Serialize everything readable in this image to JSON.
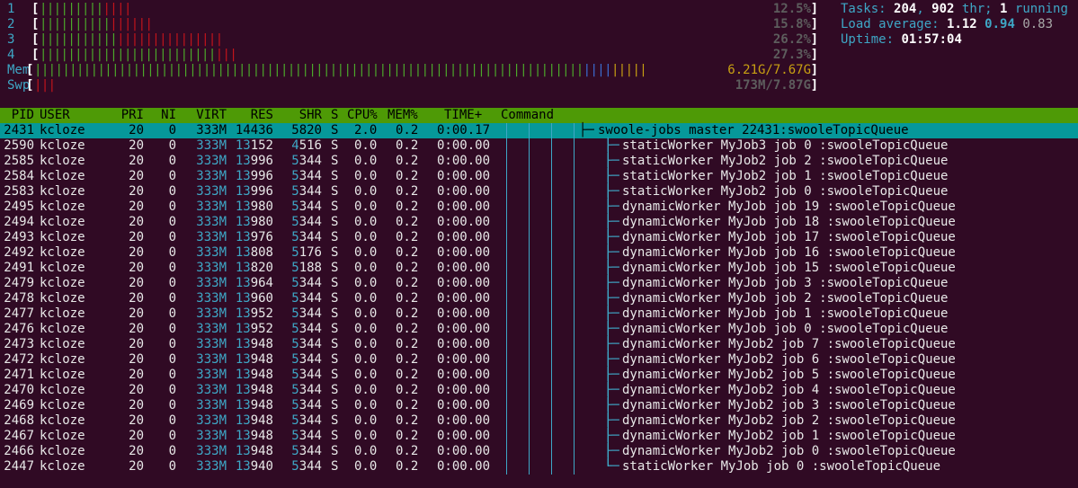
{
  "meters": {
    "cpus": [
      {
        "label": "1",
        "value": "12.5%",
        "bars": [
          {
            "c": "g",
            "n": 9
          },
          {
            "c": "r",
            "n": 4
          }
        ]
      },
      {
        "label": "2",
        "value": "15.8%",
        "bars": [
          {
            "c": "g",
            "n": 10
          },
          {
            "c": "r",
            "n": 6
          }
        ]
      },
      {
        "label": "3",
        "value": "26.2%",
        "bars": [
          {
            "c": "g",
            "n": 11
          },
          {
            "c": "r",
            "n": 15
          }
        ]
      },
      {
        "label": "4",
        "value": "27.3%",
        "bars": [
          {
            "c": "g",
            "n": 25
          },
          {
            "c": "r",
            "n": 3
          }
        ]
      }
    ],
    "mem": {
      "label": "Mem",
      "value": "6.21G/7.67G",
      "bars": [
        {
          "c": "g",
          "n": 78
        },
        {
          "c": "b",
          "n": 4
        },
        {
          "c": "y",
          "n": 5
        }
      ]
    },
    "swp": {
      "label": "Swp",
      "value": "173M/7.87G",
      "bars": [
        {
          "c": "r",
          "n": 3
        }
      ]
    },
    "colors": {
      "green": "#4caa2b",
      "red": "#c4141b",
      "blue": "#3b6fd4",
      "yellow": "#c8a012",
      "label": "#3ea7c6"
    }
  },
  "summary": {
    "tasks_label": "Tasks: ",
    "tasks": "204",
    "sep1": ", ",
    "threads": "902",
    "thr_label": " thr; ",
    "running": "1",
    "running_label": " running",
    "load_label": "Load average: ",
    "load1": "1.12",
    "load5": "0.94",
    "load15": "0.83",
    "uptime_label": "Uptime: ",
    "uptime": "01:57:04"
  },
  "columns": {
    "pid": "PID",
    "user": "USER",
    "pri": "PRI",
    "ni": "NI",
    "virt": "VIRT",
    "res": "RES",
    "shr": "SHR",
    "s": "S",
    "cpu": "CPU%",
    "mem": "MEM%",
    "time": "TIME+",
    "command": "Command"
  },
  "processes": [
    {
      "pid": "2431",
      "user": "kcloze",
      "pri": "20",
      "ni": "0",
      "virt": "333M",
      "res": "14436",
      "shr": "5820",
      "s": "S",
      "cpu": "2.0",
      "mem": "0.2",
      "time": "0:00.17",
      "branch": "├─",
      "command": "swoole-jobs master 22431:swooleTopicQueue",
      "selected": true
    },
    {
      "pid": "2590",
      "user": "kcloze",
      "pri": "20",
      "ni": "0",
      "virt": "333M",
      "res": "13152",
      "shr": "4516",
      "s": "S",
      "cpu": "0.0",
      "mem": "0.2",
      "time": "0:00.00",
      "branch": "├─",
      "command": "staticWorker MyJob3 job 0 :swooleTopicQueue"
    },
    {
      "pid": "2585",
      "user": "kcloze",
      "pri": "20",
      "ni": "0",
      "virt": "333M",
      "res": "13996",
      "shr": "5344",
      "s": "S",
      "cpu": "0.0",
      "mem": "0.2",
      "time": "0:00.00",
      "branch": "├─",
      "command": "staticWorker MyJob2 job 2 :swooleTopicQueue"
    },
    {
      "pid": "2584",
      "user": "kcloze",
      "pri": "20",
      "ni": "0",
      "virt": "333M",
      "res": "13996",
      "shr": "5344",
      "s": "S",
      "cpu": "0.0",
      "mem": "0.2",
      "time": "0:00.00",
      "branch": "├─",
      "command": "staticWorker MyJob2 job 1 :swooleTopicQueue"
    },
    {
      "pid": "2583",
      "user": "kcloze",
      "pri": "20",
      "ni": "0",
      "virt": "333M",
      "res": "13996",
      "shr": "5344",
      "s": "S",
      "cpu": "0.0",
      "mem": "0.2",
      "time": "0:00.00",
      "branch": "├─",
      "command": "staticWorker MyJob2 job 0 :swooleTopicQueue"
    },
    {
      "pid": "2495",
      "user": "kcloze",
      "pri": "20",
      "ni": "0",
      "virt": "333M",
      "res": "13980",
      "shr": "5344",
      "s": "S",
      "cpu": "0.0",
      "mem": "0.2",
      "time": "0:00.00",
      "branch": "├─",
      "command": "dynamicWorker MyJob job 19 :swooleTopicQueue"
    },
    {
      "pid": "2494",
      "user": "kcloze",
      "pri": "20",
      "ni": "0",
      "virt": "333M",
      "res": "13980",
      "shr": "5344",
      "s": "S",
      "cpu": "0.0",
      "mem": "0.2",
      "time": "0:00.00",
      "branch": "├─",
      "command": "dynamicWorker MyJob job 18 :swooleTopicQueue"
    },
    {
      "pid": "2493",
      "user": "kcloze",
      "pri": "20",
      "ni": "0",
      "virt": "333M",
      "res": "13976",
      "shr": "5344",
      "s": "S",
      "cpu": "0.0",
      "mem": "0.2",
      "time": "0:00.00",
      "branch": "├─",
      "command": "dynamicWorker MyJob job 17 :swooleTopicQueue"
    },
    {
      "pid": "2492",
      "user": "kcloze",
      "pri": "20",
      "ni": "0",
      "virt": "333M",
      "res": "13808",
      "shr": "5176",
      "s": "S",
      "cpu": "0.0",
      "mem": "0.2",
      "time": "0:00.00",
      "branch": "├─",
      "command": "dynamicWorker MyJob job 16 :swooleTopicQueue"
    },
    {
      "pid": "2491",
      "user": "kcloze",
      "pri": "20",
      "ni": "0",
      "virt": "333M",
      "res": "13820",
      "shr": "5188",
      "s": "S",
      "cpu": "0.0",
      "mem": "0.2",
      "time": "0:00.00",
      "branch": "├─",
      "command": "dynamicWorker MyJob job 15 :swooleTopicQueue"
    },
    {
      "pid": "2479",
      "user": "kcloze",
      "pri": "20",
      "ni": "0",
      "virt": "333M",
      "res": "13964",
      "shr": "5344",
      "s": "S",
      "cpu": "0.0",
      "mem": "0.2",
      "time": "0:00.00",
      "branch": "├─",
      "command": "dynamicWorker MyJob job 3 :swooleTopicQueue"
    },
    {
      "pid": "2478",
      "user": "kcloze",
      "pri": "20",
      "ni": "0",
      "virt": "333M",
      "res": "13960",
      "shr": "5344",
      "s": "S",
      "cpu": "0.0",
      "mem": "0.2",
      "time": "0:00.00",
      "branch": "├─",
      "command": "dynamicWorker MyJob job 2 :swooleTopicQueue"
    },
    {
      "pid": "2477",
      "user": "kcloze",
      "pri": "20",
      "ni": "0",
      "virt": "333M",
      "res": "13952",
      "shr": "5344",
      "s": "S",
      "cpu": "0.0",
      "mem": "0.2",
      "time": "0:00.00",
      "branch": "├─",
      "command": "dynamicWorker MyJob job 1 :swooleTopicQueue"
    },
    {
      "pid": "2476",
      "user": "kcloze",
      "pri": "20",
      "ni": "0",
      "virt": "333M",
      "res": "13952",
      "shr": "5344",
      "s": "S",
      "cpu": "0.0",
      "mem": "0.2",
      "time": "0:00.00",
      "branch": "├─",
      "command": "dynamicWorker MyJob job 0 :swooleTopicQueue"
    },
    {
      "pid": "2473",
      "user": "kcloze",
      "pri": "20",
      "ni": "0",
      "virt": "333M",
      "res": "13948",
      "shr": "5344",
      "s": "S",
      "cpu": "0.0",
      "mem": "0.2",
      "time": "0:00.00",
      "branch": "├─",
      "command": "dynamicWorker MyJob2 job 7 :swooleTopicQueue"
    },
    {
      "pid": "2472",
      "user": "kcloze",
      "pri": "20",
      "ni": "0",
      "virt": "333M",
      "res": "13948",
      "shr": "5344",
      "s": "S",
      "cpu": "0.0",
      "mem": "0.2",
      "time": "0:00.00",
      "branch": "├─",
      "command": "dynamicWorker MyJob2 job 6 :swooleTopicQueue"
    },
    {
      "pid": "2471",
      "user": "kcloze",
      "pri": "20",
      "ni": "0",
      "virt": "333M",
      "res": "13948",
      "shr": "5344",
      "s": "S",
      "cpu": "0.0",
      "mem": "0.2",
      "time": "0:00.00",
      "branch": "├─",
      "command": "dynamicWorker MyJob2 job 5 :swooleTopicQueue"
    },
    {
      "pid": "2470",
      "user": "kcloze",
      "pri": "20",
      "ni": "0",
      "virt": "333M",
      "res": "13948",
      "shr": "5344",
      "s": "S",
      "cpu": "0.0",
      "mem": "0.2",
      "time": "0:00.00",
      "branch": "├─",
      "command": "dynamicWorker MyJob2 job 4 :swooleTopicQueue"
    },
    {
      "pid": "2469",
      "user": "kcloze",
      "pri": "20",
      "ni": "0",
      "virt": "333M",
      "res": "13948",
      "shr": "5344",
      "s": "S",
      "cpu": "0.0",
      "mem": "0.2",
      "time": "0:00.00",
      "branch": "├─",
      "command": "dynamicWorker MyJob2 job 3 :swooleTopicQueue"
    },
    {
      "pid": "2468",
      "user": "kcloze",
      "pri": "20",
      "ni": "0",
      "virt": "333M",
      "res": "13948",
      "shr": "5344",
      "s": "S",
      "cpu": "0.0",
      "mem": "0.2",
      "time": "0:00.00",
      "branch": "├─",
      "command": "dynamicWorker MyJob2 job 2 :swooleTopicQueue"
    },
    {
      "pid": "2467",
      "user": "kcloze",
      "pri": "20",
      "ni": "0",
      "virt": "333M",
      "res": "13948",
      "shr": "5344",
      "s": "S",
      "cpu": "0.0",
      "mem": "0.2",
      "time": "0:00.00",
      "branch": "├─",
      "command": "dynamicWorker MyJob2 job 1 :swooleTopicQueue"
    },
    {
      "pid": "2466",
      "user": "kcloze",
      "pri": "20",
      "ni": "0",
      "virt": "333M",
      "res": "13948",
      "shr": "5344",
      "s": "S",
      "cpu": "0.0",
      "mem": "0.2",
      "time": "0:00.00",
      "branch": "├─",
      "command": "dynamicWorker MyJob2 job 0 :swooleTopicQueue"
    },
    {
      "pid": "2447",
      "user": "kcloze",
      "pri": "20",
      "ni": "0",
      "virt": "333M",
      "res": "13940",
      "shr": "5344",
      "s": "S",
      "cpu": "0.0",
      "mem": "0.2",
      "time": "0:00.00",
      "branch": "└─",
      "command": "staticWorker MyJob job 0 :swooleTopicQueue"
    }
  ]
}
